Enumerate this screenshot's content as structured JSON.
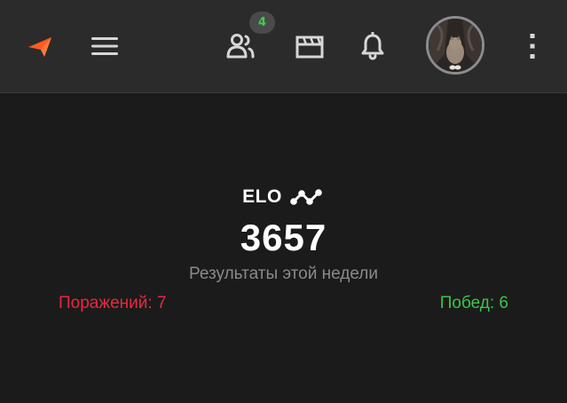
{
  "header": {
    "friends_badge_count": "4",
    "icons": {
      "logo": "orange-arrow-logo",
      "menu": "hamburger-menu-icon",
      "friends": "friends-icon",
      "videos": "clapperboard-icon",
      "notifications": "bell-icon",
      "more": "kebab-menu-icon"
    },
    "colors": {
      "logo": "#ff5a1f",
      "badge_text": "#35d14a",
      "icon": "#d7d7d7"
    }
  },
  "stats": {
    "elo_label": "ELO",
    "elo_value": "3657",
    "week_label": "Результаты этой недели",
    "losses_label": "Поражений: 7",
    "wins_label": "Побед: 6",
    "colors": {
      "losses": "#e8283f",
      "wins": "#39c54a",
      "muted": "#8a8a8a"
    }
  }
}
